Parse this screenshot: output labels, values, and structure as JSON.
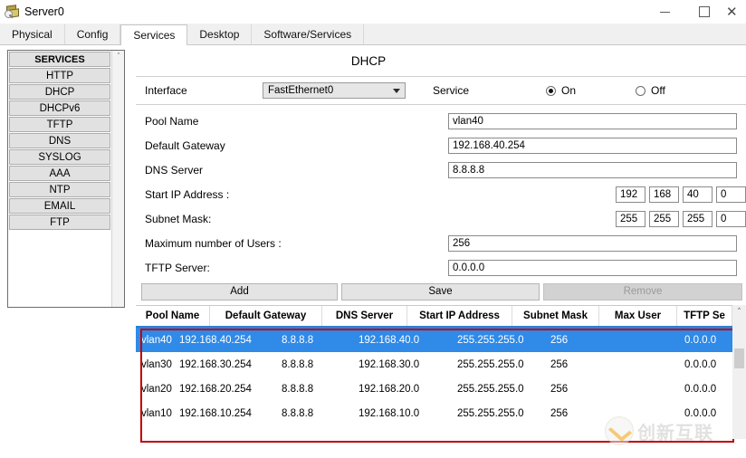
{
  "window": {
    "title": "Server0",
    "icon": "server-device-icon",
    "controls": {
      "minimize": "—",
      "maximize": "□",
      "close": "✕"
    }
  },
  "tabs": [
    {
      "label": "Physical",
      "active": false
    },
    {
      "label": "Config",
      "active": false
    },
    {
      "label": "Services",
      "active": true
    },
    {
      "label": "Desktop",
      "active": false
    },
    {
      "label": "Software/Services",
      "active": false
    }
  ],
  "sidebar": {
    "header": "SERVICES",
    "items": [
      {
        "label": "HTTP"
      },
      {
        "label": "DHCP"
      },
      {
        "label": "DHCPv6"
      },
      {
        "label": "TFTP"
      },
      {
        "label": "DNS"
      },
      {
        "label": "SYSLOG"
      },
      {
        "label": "AAA"
      },
      {
        "label": "NTP"
      },
      {
        "label": "EMAIL"
      },
      {
        "label": "FTP"
      }
    ],
    "scroll_up_icon": "˄"
  },
  "panel": {
    "title": "DHCP",
    "interface_label": "Interface",
    "interface_value": "FastEthernet0",
    "service_label": "Service",
    "service_on_label": "On",
    "service_off_label": "Off",
    "service_state": "On",
    "fields": {
      "pool_name_label": "Pool Name",
      "pool_name_value": "vlan40",
      "default_gateway_label": "Default Gateway",
      "default_gateway_value": "192.168.40.254",
      "dns_server_label": "DNS Server",
      "dns_server_value": "8.8.8.8",
      "start_ip_label": "Start IP Address :",
      "start_ip_octets": [
        "192",
        "168",
        "40",
        "0"
      ],
      "subnet_mask_label": "Subnet Mask:",
      "subnet_mask_octets": [
        "255",
        "255",
        "255",
        "0"
      ],
      "max_users_label": "Maximum number of Users :",
      "max_users_value": "256",
      "tftp_server_label": "TFTP Server:",
      "tftp_server_value": "0.0.0.0"
    },
    "buttons": {
      "add": "Add",
      "save": "Save",
      "remove": "Remove",
      "remove_disabled": true
    }
  },
  "table": {
    "columns": [
      "Pool Name",
      "Default Gateway",
      "DNS Server",
      "Start IP Address",
      "Subnet Mask",
      "Max User",
      "TFTP Se"
    ],
    "rows": [
      {
        "selected": true,
        "cells": [
          "vlan40",
          "192.168.40.254",
          "8.8.8.8",
          "192.168.40.0",
          "255.255.255.0",
          "256",
          "0.0.0.0"
        ]
      },
      {
        "selected": false,
        "cells": [
          "vlan30",
          "192.168.30.254",
          "8.8.8.8",
          "192.168.30.0",
          "255.255.255.0",
          "256",
          "0.0.0.0"
        ]
      },
      {
        "selected": false,
        "cells": [
          "vlan20",
          "192.168.20.254",
          "8.8.8.8",
          "192.168.20.0",
          "255.255.255.0",
          "256",
          "0.0.0.0"
        ]
      },
      {
        "selected": false,
        "cells": [
          "vlan10",
          "192.168.10.254",
          "8.8.8.8",
          "192.168.10.0",
          "255.255.255.0",
          "256",
          "0.0.0.0"
        ]
      }
    ],
    "scroll_up_icon": "˄"
  },
  "watermark": {
    "text": "创新互联"
  },
  "colors": {
    "selection": "#2f8ae8",
    "header_underline": "#2b7fd4",
    "annotation_box": "#c00000"
  }
}
